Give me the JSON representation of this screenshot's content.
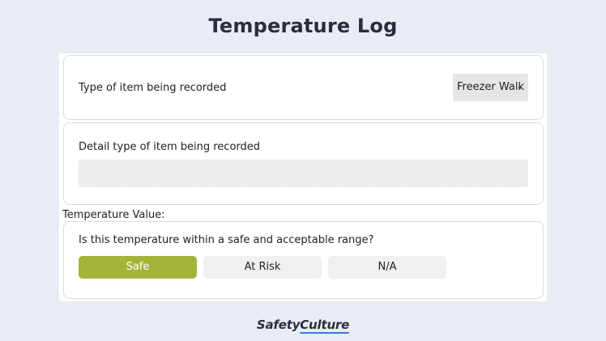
{
  "page_title": "Temperature Log",
  "item_type": {
    "label": "Type of item being recorded",
    "selected_value": "Freezer Walk"
  },
  "detail_type": {
    "label": "Detail type of item being recorded",
    "value": ""
  },
  "temperature_value": {
    "section_label": "Temperature Value:",
    "question": "Is this temperature within a safe and acceptable range?",
    "options": [
      "Safe",
      "At Risk",
      "N/A"
    ],
    "selected": "Safe"
  },
  "branding": {
    "logo_part1": "Safety",
    "logo_part2": "Culture"
  },
  "colors": {
    "background": "#e8edf5",
    "safe_button": "#a4b43a",
    "title": "#2a2d3a"
  }
}
